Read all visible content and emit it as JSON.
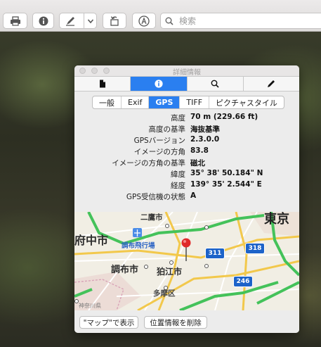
{
  "toolbar": {
    "search": {
      "placeholder": "検索"
    }
  },
  "inspector": {
    "title": "詳細情報",
    "segments": [
      {
        "name": "document-icon",
        "active": false
      },
      {
        "name": "info-icon",
        "active": true
      },
      {
        "name": "magnifier-icon",
        "active": false
      },
      {
        "name": "pencil-icon",
        "active": false
      }
    ],
    "subtabs": [
      "一般",
      "Exif",
      "GPS",
      "TIFF",
      "ピクチャスタイル"
    ],
    "active_subtab": "GPS",
    "rows": [
      {
        "key": "高度",
        "value": "70 m (229.66 ft)"
      },
      {
        "key": "高度の基準",
        "value": "海抜基準"
      },
      {
        "key": "GPSバージョン",
        "value": "2.3.0.0"
      },
      {
        "key": "イメージの方角",
        "value": "83.8"
      },
      {
        "key": "イメージの方角の基準",
        "value": "磁北"
      },
      {
        "key": "緯度",
        "value": "35° 38' 50.184\" N"
      },
      {
        "key": "経度",
        "value": "139° 35' 2.544\" E"
      },
      {
        "key": "GPS受信機の状態",
        "value": "A"
      }
    ],
    "map": {
      "labels": {
        "futaba": "二鷹市",
        "fuchu": "府中市",
        "tokyo": "東京",
        "airfield": "調布飛行場",
        "chofu": "調布市",
        "komae": "狛江市",
        "tama": "多摩区",
        "kanagawa": "神奈川県"
      },
      "shields": [
        "311",
        "318",
        "246"
      ]
    },
    "buttons": {
      "show_in_maps": "\"マップ\"で表示",
      "remove_location": "位置情報を削除"
    }
  },
  "colors": {
    "accent": "#2a7ff0",
    "route_shield": "#1d63c9",
    "pin": "#e02a2a"
  }
}
